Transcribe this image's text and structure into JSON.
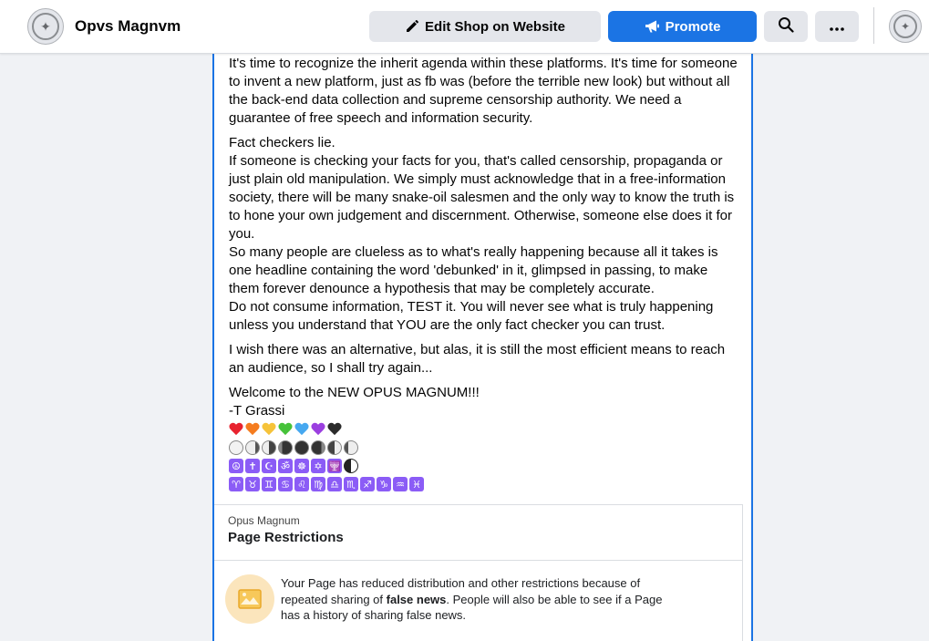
{
  "header": {
    "page_name": "Opvs Magnvm",
    "edit_shop_label": "Edit Shop on Website",
    "promote_label": "Promote"
  },
  "post": {
    "paragraphs": [
      "It's time to recognize the inherit agenda within these platforms. It's time for someone to invent a new platform, just as fb was (before the terrible new look) but without all the back-end data collection and supreme censorship authority. We need a guarantee of free speech and information security.",
      "Fact checkers lie.",
      "If someone is checking your facts for you, that's called censorship, propaganda or just plain old manipulation. We simply must acknowledge that in a free-information society, there will be many snake-oil salesmen and the only way to know the truth is to hone your own judgement and discernment. Otherwise, someone else does it for you.",
      "So many people are clueless as to what's really happening because all it takes is one headline containing the word 'debunked' in it, glimpsed in passing, to make them forever denounce a hypothesis that may be completely accurate.",
      "Do not consume information, TEST it. You will never see what is truly happening unless you understand that YOU are the only fact checker you can trust.",
      "I wish there was an alternative, but alas, it is still the most efficient means to reach an audience, so I shall try again...",
      "Welcome to the NEW OPUS MAGNUM!!!",
      "-T Grassi"
    ],
    "heart_colors": [
      "#e8232f",
      "#f57c1f",
      "#f6c33a",
      "#46c23a",
      "#46a8f0",
      "#9b3fe0",
      "#2b2b2b"
    ],
    "religious_symbols": [
      "☮",
      "✝",
      "☪",
      "ॐ",
      "☸",
      "✡",
      "🕎",
      "☯"
    ],
    "zodiac_symbols": [
      "♈",
      "♉",
      "♊",
      "♋",
      "♌",
      "♍",
      "♎",
      "♏",
      "♐",
      "♑",
      "♒",
      "♓"
    ]
  },
  "restrictions": {
    "subtitle": "Opus Magnum",
    "title": "Page Restrictions",
    "text_before": "Your Page has reduced distribution and other restrictions because of repeated sharing of ",
    "text_bold": "false news",
    "text_after": ". People will also be able to see if a Page has a history of sharing false news."
  }
}
